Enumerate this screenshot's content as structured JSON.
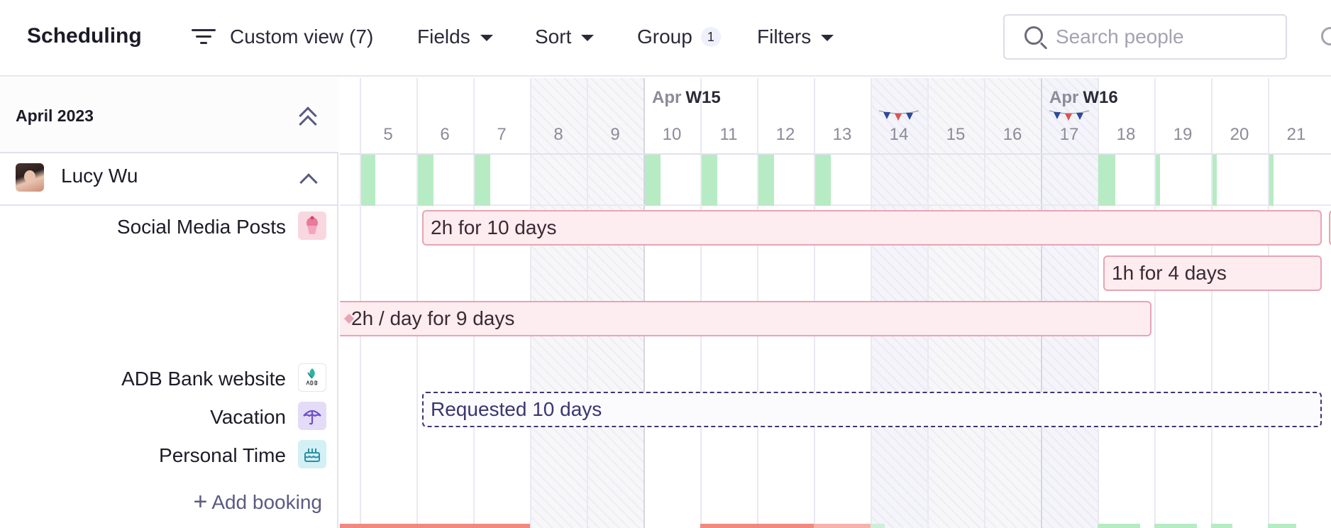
{
  "toolbar": {
    "title": "Scheduling",
    "view_label": "Custom view (7)",
    "fields_label": "Fields",
    "sort_label": "Sort",
    "group_label": "Group",
    "group_count": "1",
    "filters_label": "Filters",
    "search_placeholder": "Search people"
  },
  "sidebar": {
    "month": "April 2023",
    "person": {
      "name": "Lucy Wu",
      "projects": [
        {
          "label": "Social Media Posts",
          "icon": "cupcake-icon",
          "color": "#f9d7e0"
        },
        {
          "label": "ADB Bank website",
          "icon": "adb-logo-icon",
          "color": "#ffffff"
        },
        {
          "label": "Vacation",
          "icon": "umbrella-icon",
          "color": "#e4dcf7"
        },
        {
          "label": "Personal Time",
          "icon": "cake-icon",
          "color": "#d3f0f4"
        }
      ],
      "add_booking": "Add booking"
    }
  },
  "timeline": {
    "weeks": [
      {
        "month": "Apr",
        "week": "W15"
      },
      {
        "month": "Apr",
        "week": "W16"
      }
    ],
    "days": [
      "5",
      "6",
      "7",
      "8",
      "9",
      "10",
      "11",
      "12",
      "13",
      "14",
      "15",
      "16",
      "17",
      "18",
      "19",
      "20",
      "21"
    ],
    "bookings": [
      {
        "label": "2h for 10 days"
      },
      {
        "label": "1h for 4 days"
      },
      {
        "label": "2h / day for 9 days"
      },
      {
        "label": "Requested 10 days"
      }
    ]
  },
  "colors": {
    "availability_green": "#b7ebc4",
    "booking_pink": "#fdecf0",
    "overbooked_red": "#f08a80",
    "accent_purple": "#3b3670"
  }
}
